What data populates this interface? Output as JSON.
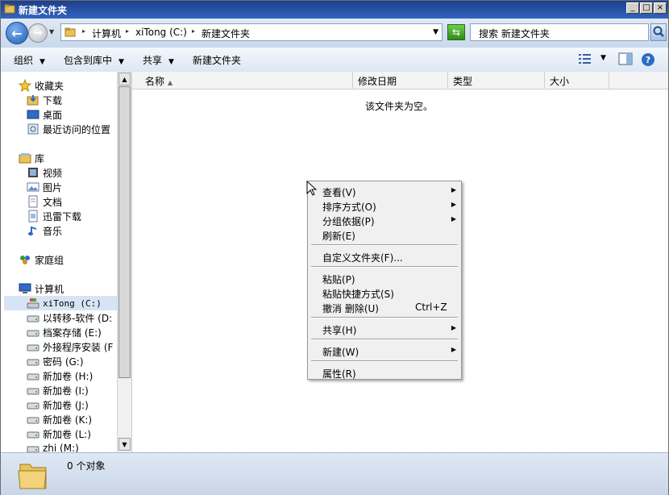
{
  "window": {
    "title": "新建文件夹",
    "buttons": {
      "minimize": "_",
      "maximize": "□",
      "close": "×"
    }
  },
  "address_bar": {
    "crumbs": [
      "计算机",
      "xiTong (C:)",
      "新建文件夹"
    ],
    "search_placeholder": "搜索 新建文件夹"
  },
  "toolbar": {
    "organize": "组织",
    "include_in_library": "包含到库中",
    "share": "共享",
    "new_folder": "新建文件夹"
  },
  "nav": {
    "favorites": {
      "label": "收藏夹",
      "items": [
        "下载",
        "桌面",
        "最近访问的位置"
      ]
    },
    "libraries": {
      "label": "库",
      "items": [
        "视频",
        "图片",
        "文档",
        "迅雷下载",
        "音乐"
      ]
    },
    "homegroup": "家庭组",
    "computer": {
      "label": "计算机",
      "drives": [
        "xiTong (C:)",
        "以转移-软件 (D:",
        "档案存储 (E:)",
        "外接程序安装 (F",
        "密码 (G:)",
        "新加卷 (H:)",
        "新加卷 (I:)",
        "新加卷 (J:)",
        "新加卷 (K:)",
        "新加卷 (L:)",
        "zhi (M:)"
      ],
      "selected": "xiTong (C:)"
    }
  },
  "columns": [
    "名称",
    "修改日期",
    "类型",
    "大小"
  ],
  "empty_message": "该文件夹为空。",
  "status": {
    "count": "0 个对象"
  },
  "context_menu": {
    "items": [
      {
        "label": "查看(V)",
        "submenu": true
      },
      {
        "label": "排序方式(O)",
        "submenu": true
      },
      {
        "label": "分组依据(P)",
        "submenu": true
      },
      {
        "label": "刷新(E)"
      },
      {
        "label": "自定义文件夹(F)..."
      },
      {
        "label": "粘贴(P)"
      },
      {
        "label": "粘贴快捷方式(S)"
      },
      {
        "label": "撤消 删除(U)",
        "shortcut": "Ctrl+Z"
      },
      {
        "label": "共享(H)",
        "submenu": true
      },
      {
        "label": "新建(W)",
        "submenu": true
      },
      {
        "label": "属性(R)"
      }
    ]
  },
  "colors": {
    "title_bar": "#2a56a8",
    "selection": "#d6e4f5",
    "menu_bg": "#f0f0f0"
  }
}
